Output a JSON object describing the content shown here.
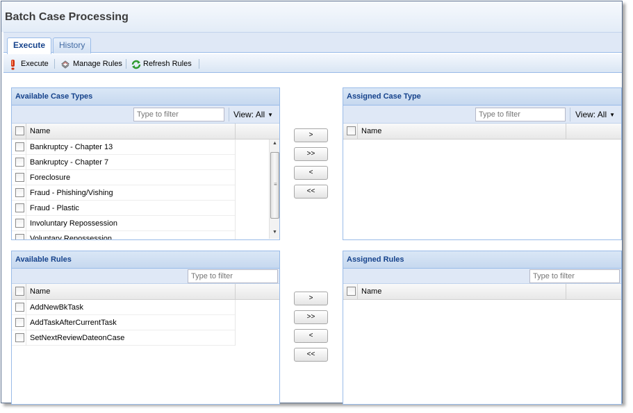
{
  "window": {
    "title": "Batch Case Processing"
  },
  "tabs": [
    {
      "label": "Execute",
      "active": true
    },
    {
      "label": "History",
      "active": false
    }
  ],
  "toolbar": {
    "execute_label": "Execute",
    "manage_rules_label": "Manage Rules",
    "refresh_rules_label": "Refresh Rules"
  },
  "available_case_types": {
    "title": "Available Case Types",
    "filter_placeholder": "Type to filter",
    "view_label": "View: All",
    "column_name": "Name",
    "items": [
      "Bankruptcy - Chapter 13",
      "Bankruptcy - Chapter 7",
      "Foreclosure",
      "Fraud - Phishing/Vishing",
      "Fraud - Plastic",
      "Involuntary Repossession",
      "Voluntary Repossession"
    ]
  },
  "assigned_case_type": {
    "title": "Assigned Case Type",
    "filter_placeholder": "Type to filter",
    "view_label": "View: All",
    "column_name": "Name",
    "items": []
  },
  "available_rules": {
    "title": "Available Rules",
    "filter_placeholder": "Type to filter",
    "column_name": "Name",
    "items": [
      "AddNewBkTask",
      "AddTaskAfterCurrentTask",
      "SetNextReviewDateonCase"
    ]
  },
  "assigned_rules": {
    "title": "Assigned Rules",
    "filter_placeholder": "Type to filter",
    "column_name": "Name",
    "items": []
  },
  "move_buttons": {
    "add": ">",
    "add_all": ">>",
    "remove": "<",
    "remove_all": "<<"
  },
  "colors": {
    "panel_header_text": "#15428b",
    "panel_border": "#99bbe8",
    "toolbar_bg": "#dfe8f6"
  }
}
